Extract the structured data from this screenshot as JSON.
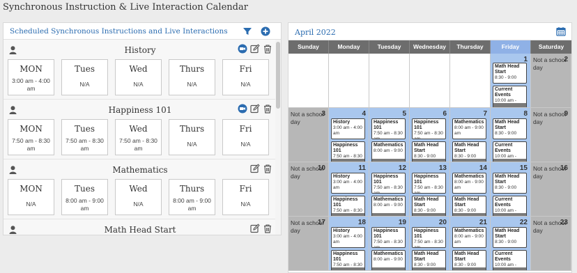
{
  "page_title": "Synchronous Instruction & Live Interaction Calendar",
  "left_panel": {
    "title": "Scheduled Synchronous Instructions and Live Interactions",
    "courses": [
      {
        "name": "History",
        "has_video": true,
        "days": [
          {
            "day": "MON",
            "time": "3:00 am - 4:00 am"
          },
          {
            "day": "Tues",
            "time": "N/A"
          },
          {
            "day": "Wed",
            "time": "N/A"
          },
          {
            "day": "Thurs",
            "time": "N/A"
          },
          {
            "day": "Fri",
            "time": "N/A"
          }
        ]
      },
      {
        "name": "Happiness 101",
        "has_video": true,
        "days": [
          {
            "day": "MON",
            "time": "7:50 am - 8:30 am"
          },
          {
            "day": "Tues",
            "time": "7:50 am - 8:30 am"
          },
          {
            "day": "Wed",
            "time": "7:50 am - 8:30 am"
          },
          {
            "day": "Thurs",
            "time": "N/A"
          },
          {
            "day": "Fri",
            "time": "N/A"
          }
        ]
      },
      {
        "name": "Mathematics",
        "has_video": false,
        "days": [
          {
            "day": "MON",
            "time": "N/A"
          },
          {
            "day": "Tues",
            "time": "8:00 am - 9:00 am"
          },
          {
            "day": "Wed",
            "time": "N/A"
          },
          {
            "day": "Thurs",
            "time": "8:00 am - 9:00 am"
          },
          {
            "day": "Fri",
            "time": "N/A"
          }
        ]
      },
      {
        "name": "Math Head Start",
        "has_video": false,
        "days": []
      }
    ]
  },
  "calendar": {
    "month": "April 2022",
    "weekdays": [
      "Sunday",
      "Monday",
      "Tuesday",
      "Wednesday",
      "Thursday",
      "Friday",
      "Saturday"
    ],
    "not_school_day": "Not a school day",
    "rows": [
      [
        {
          "date": "",
          "style": "white"
        },
        {
          "date": "",
          "style": "white"
        },
        {
          "date": "",
          "style": "white"
        },
        {
          "date": "",
          "style": "white"
        },
        {
          "date": "",
          "style": "white"
        },
        {
          "date": "1",
          "style": "blue",
          "events": [
            {
              "title": "Math Head Start",
              "time": "8:30 - 9:00"
            },
            {
              "title": "Current Events",
              "time": "10:00 am -"
            }
          ]
        },
        {
          "date": "2",
          "style": "gray",
          "nsd": true
        }
      ],
      [
        {
          "date": "3",
          "style": "gray",
          "nsd": true
        },
        {
          "date": "4",
          "style": "blue",
          "events": [
            {
              "title": "History",
              "time": "3:00 am - 4:00 am"
            },
            {
              "title": "Happiness 101",
              "time": "7:50 am - 8:30"
            }
          ]
        },
        {
          "date": "5",
          "style": "blue",
          "events": [
            {
              "title": "Happiness 101",
              "time": "7:50 am - 8:30 am"
            },
            {
              "title": "Mathematics",
              "time": "8:00 am - 9:00"
            }
          ]
        },
        {
          "date": "6",
          "style": "blue",
          "events": [
            {
              "title": "Happiness 101",
              "time": "7:50 am - 8:30 am"
            },
            {
              "title": "Math Head Start",
              "time": "8:30 - 9:00"
            }
          ]
        },
        {
          "date": "7",
          "style": "blue",
          "events": [
            {
              "title": "Mathematics",
              "time": "8:00 am - 9:00 am"
            },
            {
              "title": "Math Head Start",
              "time": "8:30 - 9:00"
            }
          ]
        },
        {
          "date": "8",
          "style": "blue",
          "events": [
            {
              "title": "Math Head Start",
              "time": "8:30 - 9:00"
            },
            {
              "title": "Current Events",
              "time": "10:00 am -"
            }
          ]
        },
        {
          "date": "9",
          "style": "gray",
          "nsd": true
        }
      ],
      [
        {
          "date": "10",
          "style": "gray",
          "nsd": true
        },
        {
          "date": "11",
          "style": "blue",
          "events": [
            {
              "title": "History",
              "time": "3:00 am - 4:00 am"
            },
            {
              "title": "Happiness 101",
              "time": "7:50 am - 8:30"
            }
          ]
        },
        {
          "date": "12",
          "style": "blue",
          "events": [
            {
              "title": "Happiness 101",
              "time": "7:50 am - 8:30 am"
            },
            {
              "title": "Mathematics",
              "time": "8:00 am - 9:00"
            }
          ]
        },
        {
          "date": "13",
          "style": "blue",
          "events": [
            {
              "title": "Happiness 101",
              "time": "7:50 am - 8:30 am"
            },
            {
              "title": "Math Head Start",
              "time": "8:30 - 9:00"
            }
          ]
        },
        {
          "date": "14",
          "style": "blue",
          "events": [
            {
              "title": "Mathematics",
              "time": "8:00 am - 9:00 am"
            },
            {
              "title": "Math Head Start",
              "time": "8:30 - 9:00"
            }
          ]
        },
        {
          "date": "15",
          "style": "blue",
          "events": [
            {
              "title": "Math Head Start",
              "time": "8:30 - 9:00"
            },
            {
              "title": "Current Events",
              "time": "10:00 am -"
            }
          ]
        },
        {
          "date": "16",
          "style": "gray",
          "nsd": true
        }
      ],
      [
        {
          "date": "17",
          "style": "gray",
          "nsd": true
        },
        {
          "date": "18",
          "style": "blue",
          "events": [
            {
              "title": "History",
              "time": "3:00 am - 4:00 am"
            },
            {
              "title": "Happiness 101",
              "time": "7:50 am - 8:30"
            }
          ]
        },
        {
          "date": "19",
          "style": "blue",
          "events": [
            {
              "title": "Happiness 101",
              "time": "7:50 am - 8:30 am"
            },
            {
              "title": "Mathematics",
              "time": "8:00 am - 9:00"
            }
          ]
        },
        {
          "date": "20",
          "style": "blue",
          "events": [
            {
              "title": "Happiness 101",
              "time": "7:50 am - 8:30 am"
            },
            {
              "title": "Math Head Start",
              "time": "8:30 - 9:00"
            }
          ]
        },
        {
          "date": "21",
          "style": "blue",
          "events": [
            {
              "title": "Mathematics",
              "time": "8:00 am - 9:00 am"
            },
            {
              "title": "Math Head Start",
              "time": "8:30 - 9:00"
            }
          ]
        },
        {
          "date": "22",
          "style": "blue",
          "events": [
            {
              "title": "Math Head Start",
              "time": "8:30 - 9:00"
            },
            {
              "title": "Current Events",
              "time": "10:00 am -"
            }
          ]
        },
        {
          "date": "23",
          "style": "gray",
          "nsd": true
        }
      ]
    ]
  },
  "colors": {
    "accent": "#2b6cb0",
    "weekday_bar": "#6d6d6d",
    "school_day": "#a9c7ee",
    "non_school_day": "#b7b7b7"
  },
  "icons": [
    "user-icon",
    "filter-icon",
    "plus-circle-icon",
    "video-icon",
    "edit-icon",
    "trash-icon",
    "calendar-icon",
    "chevron-down-icon"
  ]
}
